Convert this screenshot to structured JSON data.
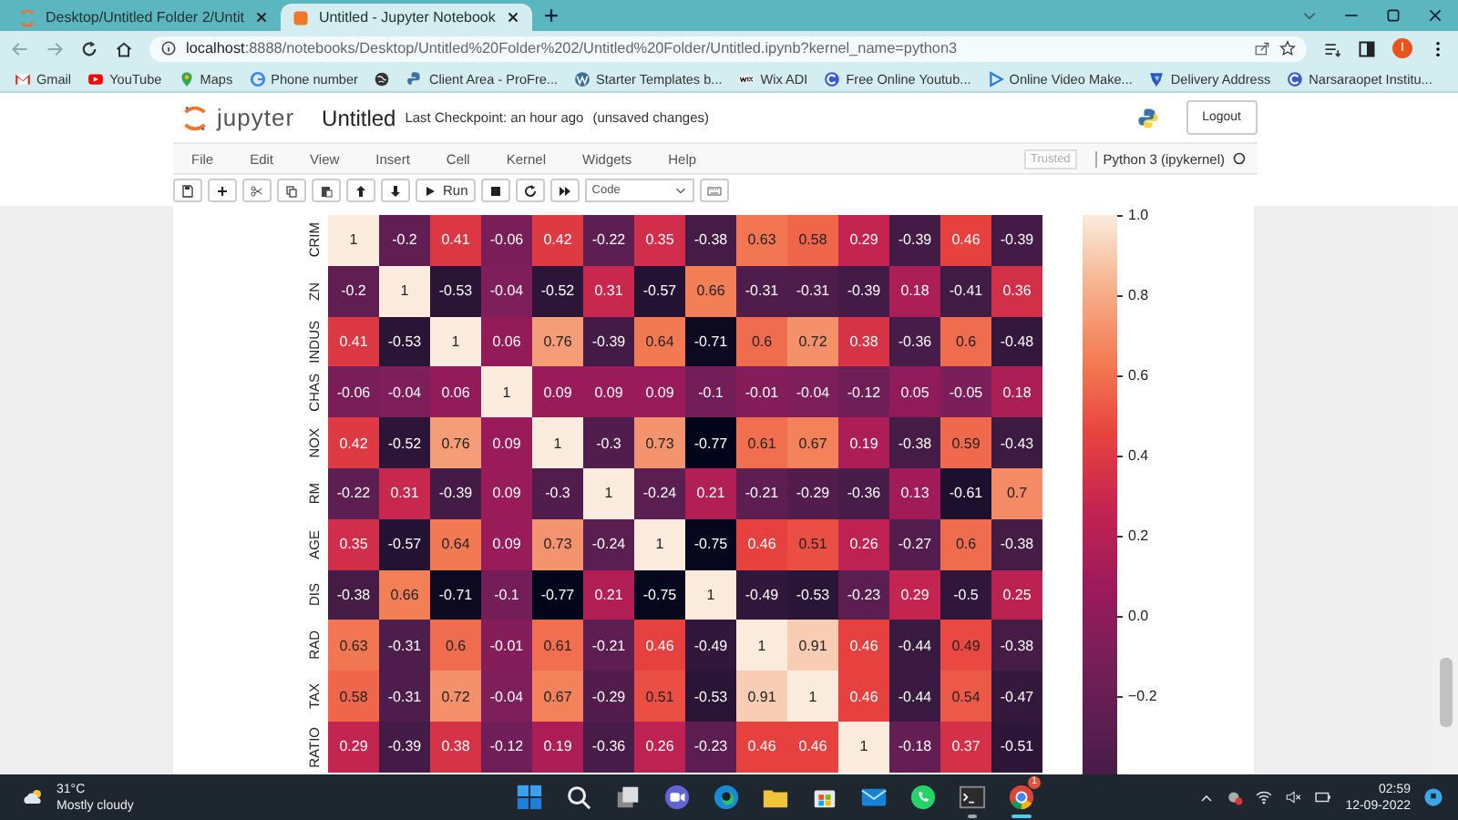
{
  "browser": {
    "tabs": [
      {
        "title": "Desktop/Untitled Folder 2/Untit",
        "kind": "folder",
        "selected": false
      },
      {
        "title": "Untitled - Jupyter Notebook",
        "kind": "notebook",
        "selected": true
      }
    ],
    "url": "**localhost**:8888/notebooks/Desktop/Untitled%20Folder%202/Untitled%20Folder/Untitled.ipynb?kernel_name=python3",
    "profile_initial": "I",
    "bookmarks": [
      {
        "label": "Gmail",
        "kind": "mail"
      },
      {
        "label": "YouTube",
        "kind": "video"
      },
      {
        "label": "Maps",
        "kind": "pin"
      },
      {
        "label": "Phone number",
        "kind": "g"
      },
      {
        "kind": "globe"
      },
      {
        "label": "Client Area - ProFre...",
        "kind": "snake"
      },
      {
        "label": "Starter Templates b...",
        "kind": "wp"
      },
      {
        "label": "Wix ADI",
        "kind": "wix"
      },
      {
        "label": "Free Online Youtub...",
        "kind": "c"
      },
      {
        "label": "Online Video Make...",
        "kind": "play"
      },
      {
        "label": "Delivery Address",
        "kind": "shield"
      },
      {
        "label": "Narsaraopet Institu...",
        "kind": "c"
      }
    ]
  },
  "notebook": {
    "logo": "jupyter",
    "title": "Untitled",
    "checkpoint": "Last Checkpoint: an hour ago",
    "status": "(unsaved changes)",
    "logout": "Logout",
    "menus": [
      "File",
      "Edit",
      "View",
      "Insert",
      "Cell",
      "Kernel",
      "Widgets",
      "Help"
    ],
    "trusted": "Trusted",
    "kernel": "Python 3 (ipykernel)",
    "toolbar": [
      {
        "kind": "save"
      },
      {
        "kind": "add"
      },
      {
        "kind": "cut"
      },
      {
        "kind": "copy"
      },
      {
        "kind": "paste"
      },
      {
        "kind": "up"
      },
      {
        "kind": "down"
      },
      {
        "kind": "run",
        "label": "Run"
      },
      {
        "kind": "stop"
      },
      {
        "kind": "restart"
      },
      {
        "kind": "ff"
      },
      {
        "kind": "select",
        "label": "Code"
      },
      {
        "kind": "keyboard"
      }
    ]
  },
  "heatmap": {
    "rows": [
      {
        "label": "CRIM",
        "values": [
          "1",
          "-0.2",
          "0.41",
          "-0.06",
          "0.42",
          "-0.22",
          "0.35",
          "-0.38",
          "0.63",
          "0.58",
          "0.29",
          "-0.39",
          "0.46",
          "-0.39"
        ]
      },
      {
        "label": "ZN",
        "values": [
          "-0.2",
          "1",
          "-0.53",
          "-0.04",
          "-0.52",
          "0.31",
          "-0.57",
          "0.66",
          "-0.31",
          "-0.31",
          "-0.39",
          "0.18",
          "-0.41",
          "0.36"
        ]
      },
      {
        "label": "INDUS",
        "values": [
          "0.41",
          "-0.53",
          "1",
          "0.06",
          "0.76",
          "-0.39",
          "0.64",
          "-0.71",
          "0.6",
          "0.72",
          "0.38",
          "-0.36",
          "0.6",
          "-0.48"
        ]
      },
      {
        "label": "CHAS",
        "values": [
          "-0.06",
          "-0.04",
          "0.06",
          "1",
          "0.09",
          "0.09",
          "0.09",
          "-0.1",
          "-0.01",
          "-0.04",
          "-0.12",
          "0.05",
          "-0.05",
          "0.18"
        ]
      },
      {
        "label": "NOX",
        "values": [
          "0.42",
          "-0.52",
          "0.76",
          "0.09",
          "1",
          "-0.3",
          "0.73",
          "-0.77",
          "0.61",
          "0.67",
          "0.19",
          "-0.38",
          "0.59",
          "-0.43"
        ]
      },
      {
        "label": "RM",
        "values": [
          "-0.22",
          "0.31",
          "-0.39",
          "0.09",
          "-0.3",
          "1",
          "-0.24",
          "0.21",
          "-0.21",
          "-0.29",
          "-0.36",
          "0.13",
          "-0.61",
          "0.7"
        ]
      },
      {
        "label": "AGE",
        "values": [
          "0.35",
          "-0.57",
          "0.64",
          "0.09",
          "0.73",
          "-0.24",
          "1",
          "-0.75",
          "0.46",
          "0.51",
          "0.26",
          "-0.27",
          "0.6",
          "-0.38"
        ]
      },
      {
        "label": "DIS",
        "values": [
          "-0.38",
          "0.66",
          "-0.71",
          "-0.1",
          "-0.77",
          "0.21",
          "-0.75",
          "1",
          "-0.49",
          "-0.53",
          "-0.23",
          "0.29",
          "-0.5",
          "0.25"
        ]
      },
      {
        "label": "RAD",
        "values": [
          "0.63",
          "-0.31",
          "0.6",
          "-0.01",
          "0.61",
          "-0.21",
          "0.46",
          "-0.49",
          "1",
          "0.91",
          "0.46",
          "-0.44",
          "0.49",
          "-0.38"
        ]
      },
      {
        "label": "TAX",
        "values": [
          "0.58",
          "-0.31",
          "0.72",
          "-0.04",
          "0.67",
          "-0.29",
          "0.51",
          "-0.53",
          "0.91",
          "1",
          "0.46",
          "-0.44",
          "0.54",
          "-0.47"
        ]
      },
      {
        "label": "RATIO",
        "values": [
          "0.29",
          "-0.39",
          "0.38",
          "-0.12",
          "0.19",
          "-0.36",
          "0.26",
          "-0.23",
          "0.46",
          "0.46",
          "1",
          "-0.18",
          "0.37",
          "-0.51"
        ]
      }
    ],
    "colorbar_ticks": [
      "1.0",
      "0.8",
      "0.6",
      "0.4",
      "0.2",
      "0.0",
      "−0.2"
    ]
  },
  "taskbar": {
    "temperature": "31°C",
    "condition": "Mostly cloudy",
    "apps": [
      {
        "kind": "start",
        "running": false
      },
      {
        "kind": "search",
        "running": false
      },
      {
        "kind": "taskview",
        "running": false
      },
      {
        "kind": "chat",
        "running": false
      },
      {
        "kind": "edge",
        "running": false
      },
      {
        "kind": "files",
        "running": false
      },
      {
        "kind": "store",
        "running": false
      },
      {
        "kind": "mail",
        "running": false
      },
      {
        "kind": "whatsapp",
        "running": false
      },
      {
        "kind": "terminal",
        "running": true
      },
      {
        "kind": "chrome",
        "running": true,
        "badge": "1"
      }
    ],
    "time": "02:59",
    "date": "12-09-2022"
  }
}
